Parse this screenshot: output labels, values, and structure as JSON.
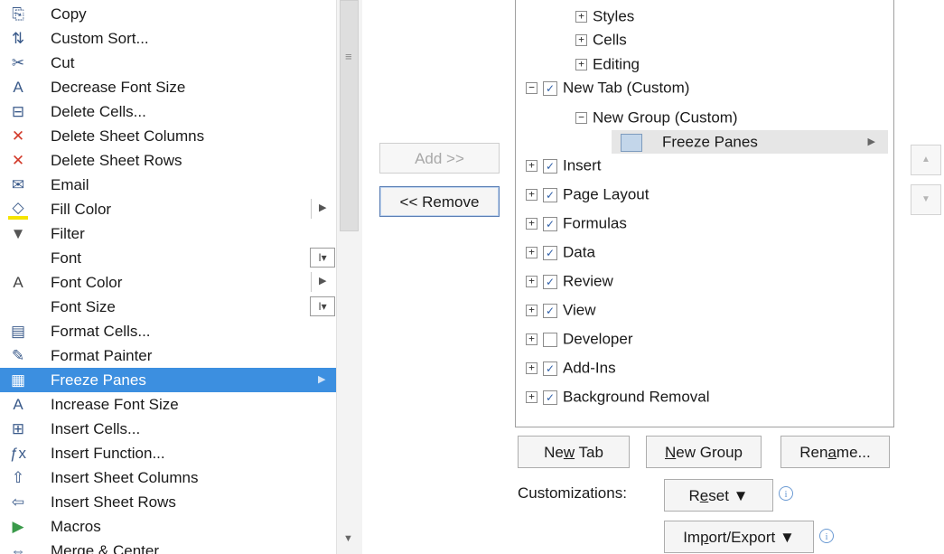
{
  "commands": [
    {
      "label": "Copy",
      "icon": "copy-icon",
      "glyph": "⎘"
    },
    {
      "label": "Custom Sort...",
      "icon": "custom-sort-icon",
      "glyph": "⇅"
    },
    {
      "label": "Cut",
      "icon": "scissors-icon",
      "glyph": "✂"
    },
    {
      "label": "Decrease Font Size",
      "icon": "decrease-font-icon",
      "glyph": "A"
    },
    {
      "label": "Delete Cells...",
      "icon": "delete-cells-icon",
      "glyph": "⊟"
    },
    {
      "label": "Delete Sheet Columns",
      "icon": "delete-columns-icon",
      "glyph": "✕"
    },
    {
      "label": "Delete Sheet Rows",
      "icon": "delete-rows-icon",
      "glyph": "✕"
    },
    {
      "label": "Email",
      "icon": "email-icon",
      "glyph": "✉"
    },
    {
      "label": "Fill Color",
      "icon": "fill-color-icon",
      "glyph": "◇"
    },
    {
      "label": "Filter",
      "icon": "filter-icon",
      "glyph": "▼"
    },
    {
      "label": "Font",
      "icon": "",
      "glyph": ""
    },
    {
      "label": "Font Color",
      "icon": "font-color-icon",
      "glyph": "A"
    },
    {
      "label": "Font Size",
      "icon": "",
      "glyph": ""
    },
    {
      "label": "Format Cells...",
      "icon": "format-cells-icon",
      "glyph": "▤"
    },
    {
      "label": "Format Painter",
      "icon": "format-painter-icon",
      "glyph": "✎"
    },
    {
      "label": "Freeze Panes",
      "icon": "freeze-panes-icon",
      "glyph": "▦"
    },
    {
      "label": "Increase Font Size",
      "icon": "increase-font-icon",
      "glyph": "A"
    },
    {
      "label": "Insert Cells...",
      "icon": "insert-cells-icon",
      "glyph": "⊞"
    },
    {
      "label": "Insert Function...",
      "icon": "function-icon",
      "glyph": "ƒx"
    },
    {
      "label": "Insert Sheet Columns",
      "icon": "insert-columns-icon",
      "glyph": "⇧"
    },
    {
      "label": "Insert Sheet Rows",
      "icon": "insert-rows-icon",
      "glyph": "⇦"
    },
    {
      "label": "Macros",
      "icon": "macro-play-icon",
      "glyph": "▶"
    },
    {
      "label": "Merge & Center",
      "icon": "merge-center-icon",
      "glyph": "⇔"
    }
  ],
  "buttons": {
    "add": "Add >>",
    "remove": "<< Remove",
    "new_tab": "New Tab",
    "new_group": "New Group",
    "rename": "Rename...",
    "reset": "Reset ▼",
    "import_export": "Import/Export ▼"
  },
  "tree": {
    "styles": "Styles",
    "cells": "Cells",
    "editing": "Editing",
    "new_tab": "New Tab (Custom)",
    "new_group": "New Group (Custom)",
    "freeze_panes": "Freeze Panes",
    "tabs": [
      {
        "label": "Insert",
        "checked": true
      },
      {
        "label": "Page Layout",
        "checked": true
      },
      {
        "label": "Formulas",
        "checked": true
      },
      {
        "label": "Data",
        "checked": true
      },
      {
        "label": "Review",
        "checked": true
      },
      {
        "label": "View",
        "checked": true
      },
      {
        "label": "Developer",
        "checked": false
      },
      {
        "label": "Add-Ins",
        "checked": true
      },
      {
        "label": "Background Removal",
        "checked": true
      }
    ]
  },
  "customizations_label": "Customizations:",
  "colors": {
    "selection": "#3c8fe0",
    "check": "#2f5fa8"
  }
}
